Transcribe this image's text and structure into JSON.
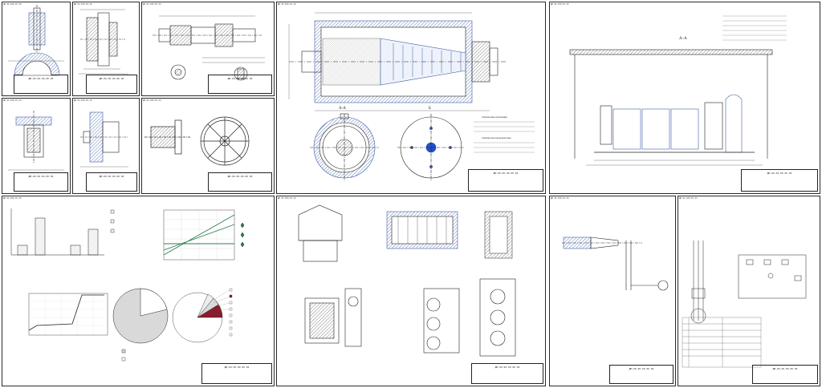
{
  "colors": {
    "line": "#1b1b1b",
    "hatch": "#3f5ea8",
    "accent": "#2450c8",
    "green": "#2e7d4f",
    "gray": "#9a9a9a",
    "red": "#8b1c2a"
  },
  "sheets": [
    {
      "id": "sheet-1",
      "stamp": "ДП 02.070.07.ХХ",
      "title": "ДП.ХХ.ХХ.ХХ.ХХ ХХ"
    },
    {
      "id": "sheet-2",
      "stamp": "ДП 02.070.07.ХХ",
      "title": "ДП.ХХ.ХХ.ХХ.ХХ ХХ"
    },
    {
      "id": "sheet-3",
      "stamp": "ДП 02.070.07.ХХ",
      "title": "ДП.ХХ.ХХ.ХХ.ХХ ХХ"
    },
    {
      "id": "sheet-4",
      "stamp": "ДП 02.070.07.ХХ",
      "title": "ДП.ХХ.ХХ.ХХ.ХХ ХХ"
    },
    {
      "id": "sheet-5",
      "stamp": "ДП 02.070.07.ХХ",
      "title": "ДП.ХХ.ХХ.ХХ.ХХ ХХ"
    },
    {
      "id": "sheet-6",
      "stamp": "ДП 02.070.07.ХХ",
      "title": "ДП.ХХ.ХХ.ХХ.ХХ ХХ"
    },
    {
      "id": "sheet-7",
      "stamp": "ДП 02.070.07.ХХ",
      "title": "ДП.ХХ.ХХ.ХХ.ХХ ХХ"
    },
    {
      "id": "sheet-8",
      "stamp": "ДП 02.070.07.ХХ",
      "title": "ДП.ХХ.ХХ.ХХ.ХХ ХХ"
    },
    {
      "id": "sheet-9",
      "stamp": "ДП 02.070.07.ХХ",
      "title": "ДП.ХХ.ХХ.ХХ.ХХ ХХ"
    },
    {
      "id": "sheet-10",
      "stamp": "ДП 02.070.07.ХХ",
      "title": "ДП.ХХ.ХХ.ХХ.ХХ ХХ"
    },
    {
      "id": "sheet-11",
      "stamp": "ДП 02.070.07.ХХ",
      "title": "ДП.ХХ.ХХ.ХХ.ХХ ХХ"
    },
    {
      "id": "sheet-12",
      "stamp": "ДП 02.070.07.ХХ",
      "title": "ДП.ХХ.ХХ.ХХ.ХХ ХХ"
    },
    {
      "id": "sheet-13",
      "stamp": "ДП 02.070.07.ХХ",
      "title": "ДП.ХХ.ХХ.ХХ.ХХ ХХ"
    }
  ],
  "labels": {
    "section_aa": "А-А",
    "section_b": "Б",
    "section_aa_plant": "А–А",
    "tech_requirements": "Технические требования",
    "tech_characteristics": "Техническая характеристика"
  }
}
